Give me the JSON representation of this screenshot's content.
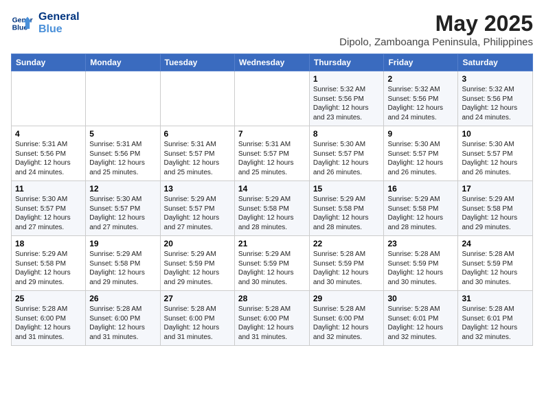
{
  "header": {
    "logo_line1": "General",
    "logo_line2": "Blue",
    "month_title": "May 2025",
    "subtitle": "Dipolo, Zamboanga Peninsula, Philippines"
  },
  "days_of_week": [
    "Sunday",
    "Monday",
    "Tuesday",
    "Wednesday",
    "Thursday",
    "Friday",
    "Saturday"
  ],
  "weeks": [
    [
      {
        "day": "",
        "info": ""
      },
      {
        "day": "",
        "info": ""
      },
      {
        "day": "",
        "info": ""
      },
      {
        "day": "",
        "info": ""
      },
      {
        "day": "1",
        "info": "Sunrise: 5:32 AM\nSunset: 5:56 PM\nDaylight: 12 hours and 23 minutes."
      },
      {
        "day": "2",
        "info": "Sunrise: 5:32 AM\nSunset: 5:56 PM\nDaylight: 12 hours and 24 minutes."
      },
      {
        "day": "3",
        "info": "Sunrise: 5:32 AM\nSunset: 5:56 PM\nDaylight: 12 hours and 24 minutes."
      }
    ],
    [
      {
        "day": "4",
        "info": "Sunrise: 5:31 AM\nSunset: 5:56 PM\nDaylight: 12 hours and 24 minutes."
      },
      {
        "day": "5",
        "info": "Sunrise: 5:31 AM\nSunset: 5:56 PM\nDaylight: 12 hours and 25 minutes."
      },
      {
        "day": "6",
        "info": "Sunrise: 5:31 AM\nSunset: 5:57 PM\nDaylight: 12 hours and 25 minutes."
      },
      {
        "day": "7",
        "info": "Sunrise: 5:31 AM\nSunset: 5:57 PM\nDaylight: 12 hours and 25 minutes."
      },
      {
        "day": "8",
        "info": "Sunrise: 5:30 AM\nSunset: 5:57 PM\nDaylight: 12 hours and 26 minutes."
      },
      {
        "day": "9",
        "info": "Sunrise: 5:30 AM\nSunset: 5:57 PM\nDaylight: 12 hours and 26 minutes."
      },
      {
        "day": "10",
        "info": "Sunrise: 5:30 AM\nSunset: 5:57 PM\nDaylight: 12 hours and 26 minutes."
      }
    ],
    [
      {
        "day": "11",
        "info": "Sunrise: 5:30 AM\nSunset: 5:57 PM\nDaylight: 12 hours and 27 minutes."
      },
      {
        "day": "12",
        "info": "Sunrise: 5:30 AM\nSunset: 5:57 PM\nDaylight: 12 hours and 27 minutes."
      },
      {
        "day": "13",
        "info": "Sunrise: 5:29 AM\nSunset: 5:57 PM\nDaylight: 12 hours and 27 minutes."
      },
      {
        "day": "14",
        "info": "Sunrise: 5:29 AM\nSunset: 5:58 PM\nDaylight: 12 hours and 28 minutes."
      },
      {
        "day": "15",
        "info": "Sunrise: 5:29 AM\nSunset: 5:58 PM\nDaylight: 12 hours and 28 minutes."
      },
      {
        "day": "16",
        "info": "Sunrise: 5:29 AM\nSunset: 5:58 PM\nDaylight: 12 hours and 28 minutes."
      },
      {
        "day": "17",
        "info": "Sunrise: 5:29 AM\nSunset: 5:58 PM\nDaylight: 12 hours and 29 minutes."
      }
    ],
    [
      {
        "day": "18",
        "info": "Sunrise: 5:29 AM\nSunset: 5:58 PM\nDaylight: 12 hours and 29 minutes."
      },
      {
        "day": "19",
        "info": "Sunrise: 5:29 AM\nSunset: 5:58 PM\nDaylight: 12 hours and 29 minutes."
      },
      {
        "day": "20",
        "info": "Sunrise: 5:29 AM\nSunset: 5:59 PM\nDaylight: 12 hours and 29 minutes."
      },
      {
        "day": "21",
        "info": "Sunrise: 5:29 AM\nSunset: 5:59 PM\nDaylight: 12 hours and 30 minutes."
      },
      {
        "day": "22",
        "info": "Sunrise: 5:28 AM\nSunset: 5:59 PM\nDaylight: 12 hours and 30 minutes."
      },
      {
        "day": "23",
        "info": "Sunrise: 5:28 AM\nSunset: 5:59 PM\nDaylight: 12 hours and 30 minutes."
      },
      {
        "day": "24",
        "info": "Sunrise: 5:28 AM\nSunset: 5:59 PM\nDaylight: 12 hours and 30 minutes."
      }
    ],
    [
      {
        "day": "25",
        "info": "Sunrise: 5:28 AM\nSunset: 6:00 PM\nDaylight: 12 hours and 31 minutes."
      },
      {
        "day": "26",
        "info": "Sunrise: 5:28 AM\nSunset: 6:00 PM\nDaylight: 12 hours and 31 minutes."
      },
      {
        "day": "27",
        "info": "Sunrise: 5:28 AM\nSunset: 6:00 PM\nDaylight: 12 hours and 31 minutes."
      },
      {
        "day": "28",
        "info": "Sunrise: 5:28 AM\nSunset: 6:00 PM\nDaylight: 12 hours and 31 minutes."
      },
      {
        "day": "29",
        "info": "Sunrise: 5:28 AM\nSunset: 6:00 PM\nDaylight: 12 hours and 32 minutes."
      },
      {
        "day": "30",
        "info": "Sunrise: 5:28 AM\nSunset: 6:01 PM\nDaylight: 12 hours and 32 minutes."
      },
      {
        "day": "31",
        "info": "Sunrise: 5:28 AM\nSunset: 6:01 PM\nDaylight: 12 hours and 32 minutes."
      }
    ]
  ]
}
